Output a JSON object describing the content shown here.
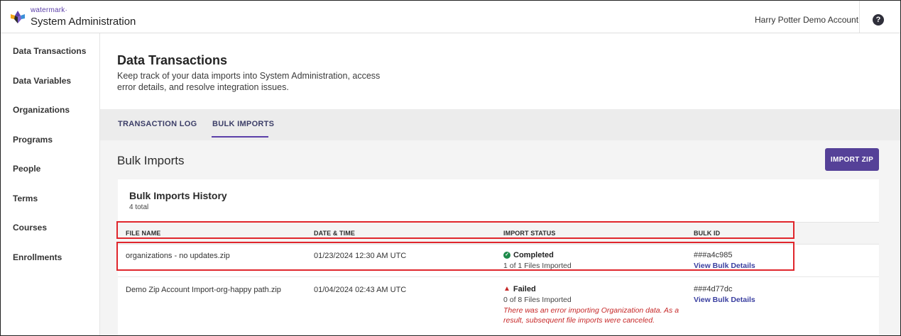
{
  "app": {
    "brand_small": "watermark·",
    "brand_title": "System Administration",
    "account": "Harry Potter Demo Account",
    "help_glyph": "?"
  },
  "sidebar": {
    "items": [
      {
        "label": "Data Transactions"
      },
      {
        "label": "Data Variables"
      },
      {
        "label": "Organizations"
      },
      {
        "label": "Programs"
      },
      {
        "label": "People"
      },
      {
        "label": "Terms"
      },
      {
        "label": "Courses"
      },
      {
        "label": "Enrollments"
      }
    ]
  },
  "page": {
    "title": "Data Transactions",
    "description": "Keep track of your data imports into System Administration, access error details, and resolve integration issues."
  },
  "tabs": [
    {
      "label": "TRANSACTION LOG",
      "active": false
    },
    {
      "label": "BULK IMPORTS",
      "active": true
    }
  ],
  "bulk": {
    "section_title": "Bulk Imports",
    "import_button": "IMPORT ZIP",
    "history_title": "Bulk Imports History",
    "total": "4 total",
    "columns": [
      "FILE NAME",
      "DATE & TIME",
      "IMPORT STATUS",
      "BULK ID"
    ],
    "rows": [
      {
        "file": "organizations - no updates.zip",
        "datetime": "01/23/2024 12:30 AM UTC",
        "status": "Completed",
        "files_imported": "1 of 1 Files Imported",
        "error": "",
        "bulk_id": "###a4c985",
        "link": "View Bulk Details"
      },
      {
        "file": "Demo Zip Account Import-org-happy path.zip",
        "datetime": "01/04/2024 02:43 AM UTC",
        "status": "Failed",
        "files_imported": "0 of 8 Files Imported",
        "error": "There was an error importing Organization data. As a result, subsequent file imports were canceled.",
        "bulk_id": "###4d77dc",
        "link": "View Bulk Details"
      }
    ]
  },
  "colors": {
    "brand": "#5b3fa8",
    "button": "#554198",
    "success": "#1d8a4a",
    "error": "#c62828",
    "highlight": "#e0262c"
  }
}
